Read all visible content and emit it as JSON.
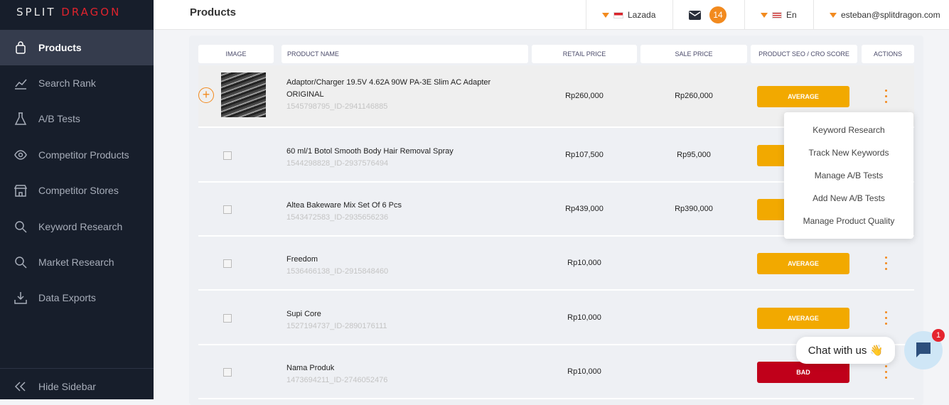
{
  "sidebar": {
    "logo_a": "SPLIT",
    "logo_b": "DRAGON",
    "items": [
      {
        "label": "Products",
        "icon": "bag-icon",
        "active": true
      },
      {
        "label": "Search Rank",
        "icon": "chart-line-icon"
      },
      {
        "label": "A/B Tests",
        "icon": "flask-icon"
      },
      {
        "label": "Competitor Products",
        "icon": "eye-icon"
      },
      {
        "label": "Competitor Stores",
        "icon": "store-icon"
      },
      {
        "label": "Keyword Research",
        "icon": "search-icon"
      },
      {
        "label": "Market Research",
        "icon": "search-icon"
      },
      {
        "label": "Data Exports",
        "icon": "download-icon"
      }
    ],
    "hide": "Hide Sidebar"
  },
  "header": {
    "title": "Products",
    "marketplace": "Lazada",
    "notifications": "14",
    "language": "En",
    "user": "esteban@splitdragon.com"
  },
  "table": {
    "headers": [
      "IMAGE",
      "PRODUCT NAME",
      "RETAIL PRICE",
      "SALE PRICE",
      "PRODUCT SEO / CRO SCORE",
      "ACTIONS"
    ],
    "rows": [
      {
        "name": "Adaptor/Charger 19.5V 4.62A 90W PA-3E Slim AC Adapter ORIGINAL",
        "id": "1545798795_ID-2941146885",
        "retail": "Rp260,000",
        "sale": "Rp260,000",
        "score": "AVERAGE"
      },
      {
        "name": "60 ml/1 Botol Smooth Body Hair Removal Spray",
        "id": "1544298828_ID-2937576494",
        "retail": "Rp107,500",
        "sale": "Rp95,000",
        "score": "AVERAGE"
      },
      {
        "name": "Altea Bakeware Mix Set Of 6 Pcs",
        "id": "1543472583_ID-2935656236",
        "retail": "Rp439,000",
        "sale": "Rp390,000",
        "score": "AVERAGE"
      },
      {
        "name": "Freedom",
        "id": "1536466138_ID-2915848460",
        "retail": "Rp10,000",
        "sale": "",
        "score": "AVERAGE"
      },
      {
        "name": "Supi Core",
        "id": "1527194737_ID-2890176111",
        "retail": "Rp10,000",
        "sale": "",
        "score": "AVERAGE"
      },
      {
        "name": "Nama Produk",
        "id": "1473694211_ID-2746052476",
        "retail": "Rp10,000",
        "sale": "",
        "score": "BAD"
      }
    ]
  },
  "menu": [
    "Keyword Research",
    "Track New Keywords",
    "Manage A/B Tests",
    "Add New A/B Tests",
    "Manage Product Quality"
  ],
  "chat": {
    "label": "Chat with us 👋",
    "badge": "1"
  },
  "colors": {
    "accent": "#f28a1e",
    "average": "#f2a900",
    "bad": "#c0001a",
    "sidebar": "#171e2b"
  }
}
